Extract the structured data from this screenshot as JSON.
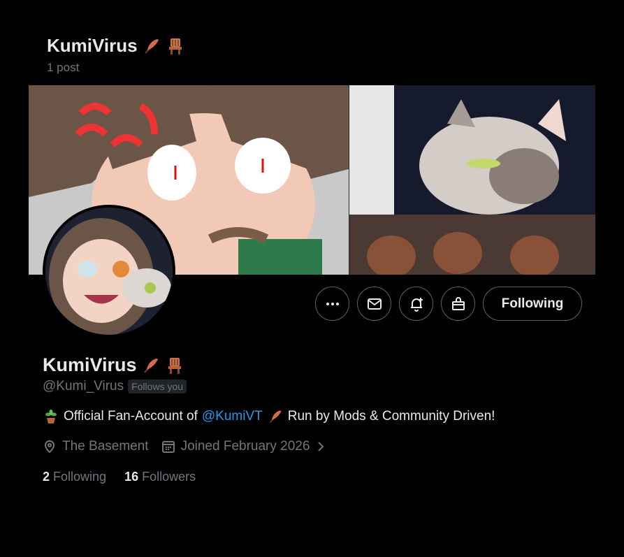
{
  "header": {
    "name": "KumiVirus",
    "posts": "1 post"
  },
  "actions": {
    "follow_label": "Following"
  },
  "profile": {
    "name": "KumiVirus",
    "handle": "@Kumi_Virus",
    "follows_you": "Follows you",
    "bio_text1": "Official Fan-Account of",
    "bio_mention": "@KumiVT",
    "bio_text2": "Run by Mods & Community Driven!",
    "location": "The Basement",
    "joined": "Joined February 2026",
    "following_count": "2",
    "following_label": "Following",
    "followers_count": "16",
    "followers_label": "Followers"
  },
  "colors": {
    "accent": "#1d9bf0",
    "muted": "#71767b",
    "text": "#e7e9ea",
    "border": "#536471"
  },
  "icons": [
    "feather-emoji",
    "chair-emoji",
    "potted-plant-emoji",
    "more-icon",
    "message-icon",
    "bell-plus-icon",
    "gift-icon",
    "location-icon",
    "calendar-icon",
    "chevron-right-icon"
  ]
}
